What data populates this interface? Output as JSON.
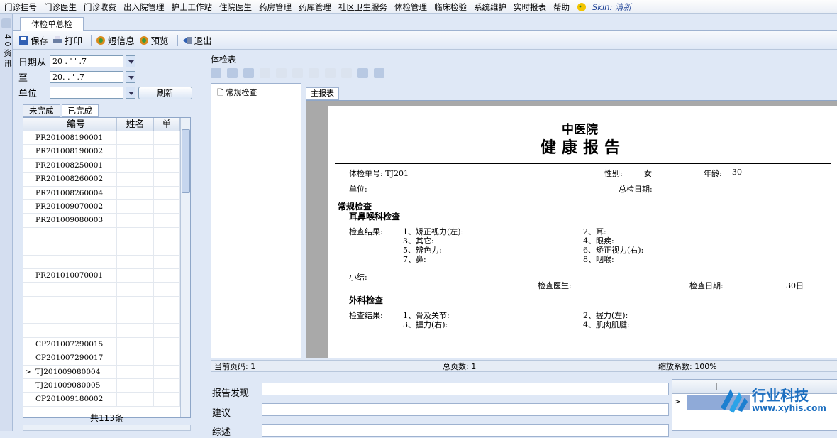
{
  "menu": [
    "门诊挂号",
    "门诊医生",
    "门诊收费",
    "出入院管理",
    "护士工作站",
    "住院医生",
    "药房管理",
    "药库管理",
    "社区卫生服务",
    "体检管理",
    "临床检验",
    "系统维护",
    "实时报表",
    "帮助"
  ],
  "skin_label": "Skin: 清新",
  "left_strip": {
    "vertical_text": "4 0 资 讯"
  },
  "doc_tab": "体检单总检",
  "toolbar": {
    "save": "保存",
    "print": "打印",
    "sms": "短信息",
    "preview": "预览",
    "exit": "退出"
  },
  "filter": {
    "date_from_label": "日期从",
    "date_from_value": "20 . ' ' .7",
    "date_to_label": "至",
    "date_to_value": "20. . ' .7",
    "unit_label": "单位",
    "unit_value": "",
    "refresh": "刷新"
  },
  "subtabs": [
    "未完成",
    "已完成"
  ],
  "grid": {
    "headers": [
      "编号",
      "姓名",
      "单"
    ],
    "rows": [
      {
        "id": "PR201008190001",
        "name": "",
        "unit": "",
        "sel": ""
      },
      {
        "id": "PR201008190002",
        "name": "",
        "unit": "",
        "sel": ""
      },
      {
        "id": "PR201008250001",
        "name": "",
        "unit": "",
        "sel": ""
      },
      {
        "id": "PR201008260002",
        "name": "",
        "unit": "",
        "sel": ""
      },
      {
        "id": "PR201008260004",
        "name": "",
        "unit": "",
        "sel": ""
      },
      {
        "id": "PR201009070002",
        "name": "",
        "unit": "",
        "sel": ""
      },
      {
        "id": "PR201009080003",
        "name": "",
        "unit": "",
        "sel": ""
      },
      {
        "id": "",
        "name": "",
        "unit": "",
        "sel": ""
      },
      {
        "id": "",
        "name": "",
        "unit": "",
        "sel": ""
      },
      {
        "id": "",
        "name": "",
        "unit": "",
        "sel": ""
      },
      {
        "id": "PR201010070001",
        "name": "",
        "unit": "",
        "sel": ""
      },
      {
        "id": "",
        "name": "",
        "unit": "",
        "sel": ""
      },
      {
        "id": "",
        "name": "",
        "unit": "",
        "sel": ""
      },
      {
        "id": "",
        "name": "",
        "unit": "",
        "sel": ""
      },
      {
        "id": "",
        "name": "",
        "unit": "",
        "sel": ""
      },
      {
        "id": "CP201007290015",
        "name": "",
        "unit": "",
        "sel": ""
      },
      {
        "id": "CP201007290017",
        "name": "",
        "unit": "",
        "sel": ""
      },
      {
        "id": "TJ201009080004",
        "name": "",
        "unit": "",
        "sel": ">"
      },
      {
        "id": "TJ201009080005",
        "name": "",
        "unit": "",
        "sel": ""
      },
      {
        "id": "CP201009180002",
        "name": "",
        "unit": "",
        "sel": ""
      }
    ],
    "footer": "共113条"
  },
  "report": {
    "panel_title": "体检表",
    "tree_item": "常规检查",
    "viewer_tab": "主报表",
    "hospital": "中医院",
    "doc_title": "健康报告",
    "exam_no_label": "体检单号: TJ201",
    "gender_label": "性别:",
    "gender_value": "女",
    "age_label": "年龄:",
    "age_value": "30",
    "unit_label": "单位:",
    "total_date_label": "总检日期:",
    "section1": "常规检查",
    "sub1": "耳鼻喉科检查",
    "result_label": "检查结果:",
    "items1": [
      "1、矫正视力(左):",
      "2、耳:",
      "3、其它:",
      "4、眼疾:",
      "5、辨色力:",
      "6、矫正视力(右):",
      "7、鼻:",
      "8、咽喉:"
    ],
    "summary_label": "小结:",
    "doctor_label": "检查医生:",
    "exam_date_label": "检查日期:",
    "exam_date_value": "30日",
    "sub2": "外科检查",
    "items2": [
      "1、骨及关节:",
      "2、握力(左):",
      "3、握力(右):",
      "4、肌肉肌腱:"
    ]
  },
  "status": {
    "current_page": "当前页码: 1",
    "total_pages": "总页数: 1",
    "zoom": "缩放系数: 100%"
  },
  "bottom": {
    "finding": "报告发现",
    "advice": "建议",
    "summary": "综述"
  },
  "mini_grid": {
    "header": "I"
  },
  "logo": {
    "name": "行业科技",
    "url": "www.xyhis.com"
  }
}
